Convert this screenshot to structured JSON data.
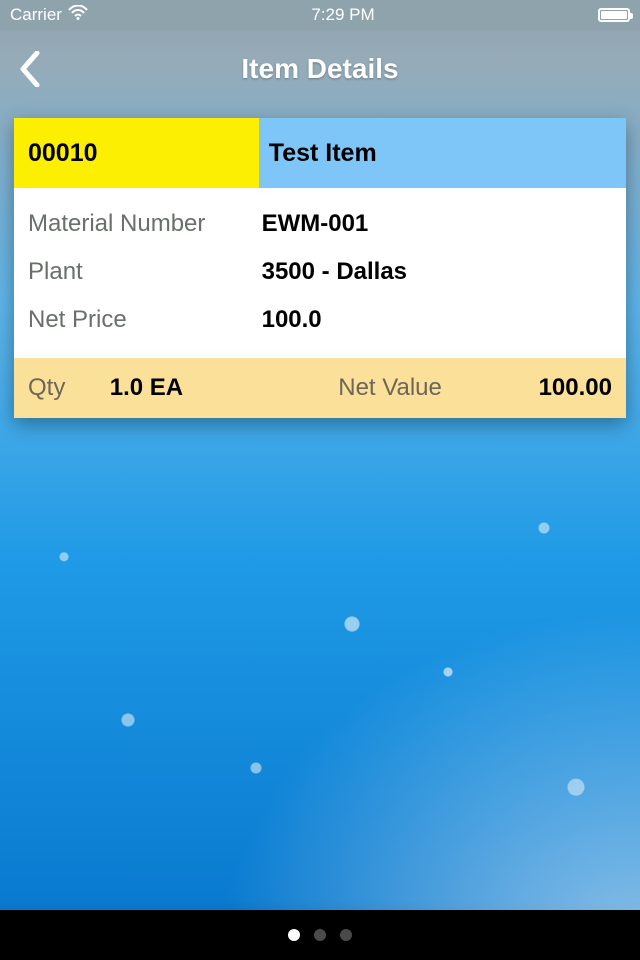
{
  "status": {
    "carrier": "Carrier",
    "time": "7:29 PM"
  },
  "nav": {
    "title": "Item Details"
  },
  "item": {
    "header": {
      "code": "00010",
      "name": "Test Item"
    },
    "details": {
      "material_number_label": "Material Number",
      "material_number": "EWM-001",
      "plant_label": "Plant",
      "plant": "3500 - Dallas",
      "net_price_label": "Net Price",
      "net_price": "100.0"
    },
    "footer": {
      "qty_label": "Qty",
      "qty_value": "1.0 EA",
      "net_value_label": "Net Value",
      "net_value": "100.00"
    }
  },
  "pager": {
    "count": 3,
    "active": 0
  }
}
